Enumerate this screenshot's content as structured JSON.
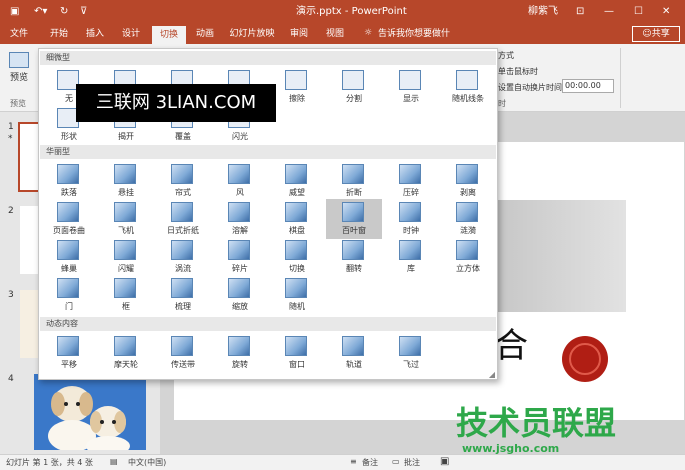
{
  "window": {
    "title": "演示.pptx - PowerPoint",
    "user": "柳紫飞",
    "share_label": "共享"
  },
  "tabs": [
    "文件",
    "开始",
    "插入",
    "设计",
    "切换",
    "动画",
    "幻灯片放映",
    "审阅",
    "视图"
  ],
  "tell_me": "告诉我你想要做什么...",
  "ribbon": {
    "preview_label": "预览",
    "preview_group": "预览",
    "after_label": "方式",
    "click_label": "单击鼠标时",
    "auto_label": "设置自动换片时间:",
    "auto_value": "00:00.00",
    "timing_group": "时"
  },
  "gallery": {
    "sections": [
      "细微型",
      "华丽型",
      "动态内容"
    ],
    "subtle_items": [
      "无",
      "",
      "",
      "",
      "擦除",
      "分割",
      "显示",
      "随机线条",
      "形状",
      "揭开",
      "覆盖",
      "闪光"
    ],
    "exciting_items": [
      "跌落",
      "悬挂",
      "帘式",
      "风",
      "威望",
      "折断",
      "压碎",
      "剥离",
      "页面卷曲",
      "飞机",
      "日式折纸",
      "溶解",
      "棋盘",
      "百叶窗",
      "时钟",
      "涟漪",
      "蜂巢",
      "闪耀",
      "涡流",
      "碎片",
      "切换",
      "翻转",
      "库",
      "立方体",
      "门",
      "框",
      "梳理",
      "缩放",
      "随机"
    ],
    "dynamic_items": [
      "平移",
      "摩天轮",
      "传送带",
      "旋转",
      "窗口",
      "轨道",
      "飞过"
    ],
    "selected": "百叶窗"
  },
  "watermark_top": "三联网 3LIAN.COM",
  "watermark_bottom": "技术员联盟",
  "watermark_url": "www.jsgho.com",
  "slides": [
    "1",
    "2",
    "3",
    "4"
  ],
  "slide_char": "合",
  "status": {
    "slide": "幻灯片 第 1 张，共 4 张",
    "lang": "中文(中国)",
    "notes": "备注",
    "comments": "批注"
  },
  "colors": {
    "accent": "#b7472a"
  }
}
